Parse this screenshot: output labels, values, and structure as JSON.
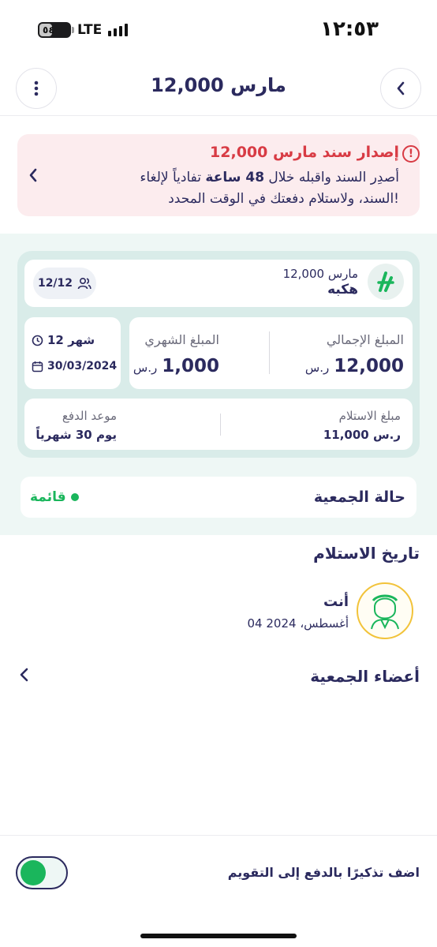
{
  "status_bar": {
    "time": "١٢:٥٣",
    "network": "LTE",
    "battery": "٥٤"
  },
  "header": {
    "title": "مارس 12,000",
    "back_icon": "chevron-left-icon",
    "menu_icon": "more-vertical-icon"
  },
  "alert": {
    "title": "إصدار سند مارس 12,000",
    "line1_prefix": "أصدِر السند واقبله خلال ",
    "line1_bold": "48 ساعة",
    "line1_suffix": " تفادياً لإلغاء",
    "line2": "السند، ولاستلام دفعتك في الوقت المحدد!",
    "color": "#d83b44"
  },
  "group_card": {
    "name_small": "مارس 12,000",
    "name_big": "هكبه",
    "members": "12/12",
    "total_label": "المبلغ الإجمالي",
    "total_value": "12,000",
    "currency": "ر.س",
    "monthly_label": "المبلغ الشهري",
    "monthly_value": "1,000",
    "duration": "12 شهر",
    "start_date": "30/03/2024",
    "receive_label": "مبلغ الاستلام",
    "receive_value": "11,000 ر.س",
    "due_label": "موعد الدفع",
    "due_value": "يوم 30 شهرياً"
  },
  "status": {
    "label": "حالة الجمعية",
    "value": "قائمة",
    "color": "#1ab65c"
  },
  "receipt_history": {
    "title": "تاريخ الاستلام",
    "person": "أنت",
    "date": "04 أغسطس، 2024"
  },
  "members_section": {
    "title": "أعضاء الجمعية"
  },
  "reminder": {
    "label": "اضف تذكيرًا بالدفع إلى التقويم",
    "enabled": true
  }
}
